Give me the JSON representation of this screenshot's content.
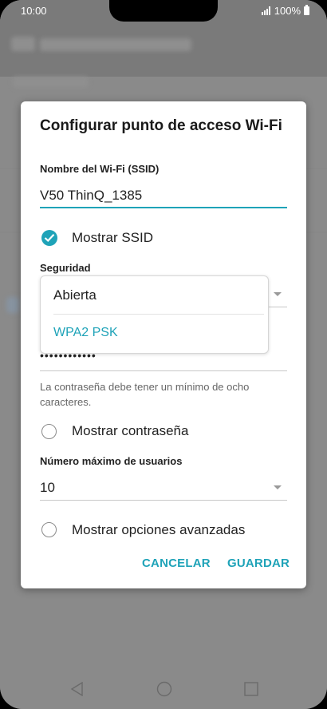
{
  "status_bar": {
    "time": "10:00",
    "battery": "100%"
  },
  "dialog": {
    "title": "Configurar punto de acceso Wi-Fi",
    "ssid_label": "Nombre del Wi-Fi (SSID)",
    "ssid_value": "V50 ThinQ_1385",
    "show_ssid_label": "Mostrar SSID",
    "show_ssid_checked": true,
    "security_label": "Seguridad",
    "password_value": "••••••••••••",
    "password_hint": "La contraseña debe tener un mínimo de ocho caracteres.",
    "show_password_label": "Mostrar contraseña",
    "max_users_label": "Número máximo de usuarios",
    "max_users_value": "10",
    "advanced_label": "Mostrar opciones avanzadas",
    "cancel_label": "CANCELAR",
    "save_label": "GUARDAR"
  },
  "security_dropdown": {
    "options": [
      "Abierta",
      "WPA2 PSK"
    ],
    "selected": "WPA2 PSK"
  },
  "colors": {
    "accent": "#1fa3b8"
  }
}
